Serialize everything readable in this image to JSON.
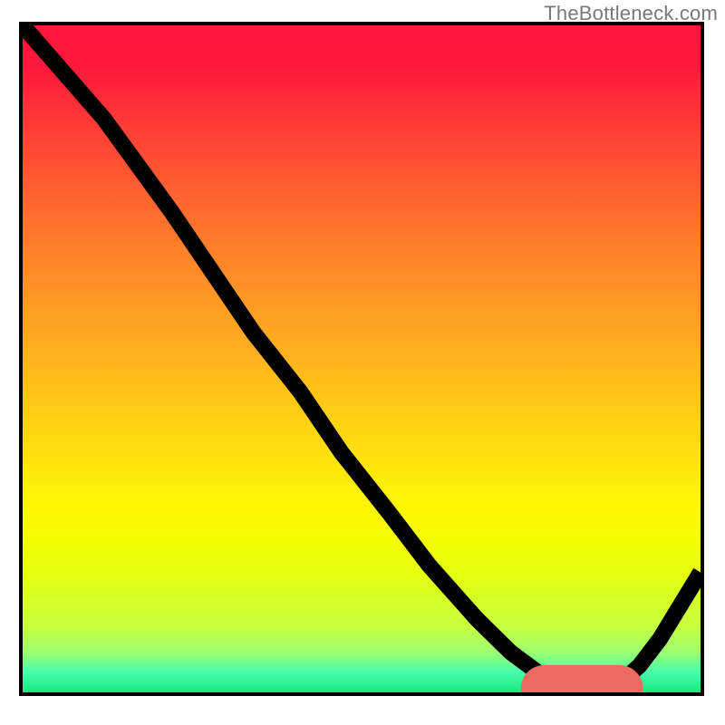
{
  "watermark": {
    "text": "TheBottleneck.com"
  },
  "chart_data": {
    "type": "line",
    "title": "",
    "xlabel": "",
    "ylabel": "",
    "xlim": [
      0,
      100
    ],
    "ylim": [
      0,
      100
    ],
    "series": [
      {
        "name": "bottleneck-curve",
        "color": "#000000",
        "x": [
          0,
          6,
          12,
          17,
          22,
          28,
          34,
          41,
          47,
          54,
          60,
          67,
          72,
          76,
          79,
          82,
          85,
          88,
          91,
          94,
          97,
          100
        ],
        "y": [
          100,
          93,
          86,
          79,
          72,
          63,
          54,
          45,
          36,
          27,
          19,
          11,
          6,
          3,
          1.2,
          0.8,
          0.8,
          1.3,
          4,
          8,
          13,
          18
        ]
      }
    ],
    "marker": {
      "name": "optimal-range",
      "color": "#ec6a5f",
      "x_start": 77,
      "x_end": 88,
      "y": 0.6
    },
    "background_gradient": {
      "stops": [
        {
          "pct": 0,
          "color": "#fe173d"
        },
        {
          "pct": 28,
          "color": "#ff6c2e"
        },
        {
          "pct": 52,
          "color": "#ffba1c"
        },
        {
          "pct": 72,
          "color": "#fef704"
        },
        {
          "pct": 90,
          "color": "#c7ff3e"
        },
        {
          "pct": 100,
          "color": "#18e97d"
        }
      ]
    }
  }
}
